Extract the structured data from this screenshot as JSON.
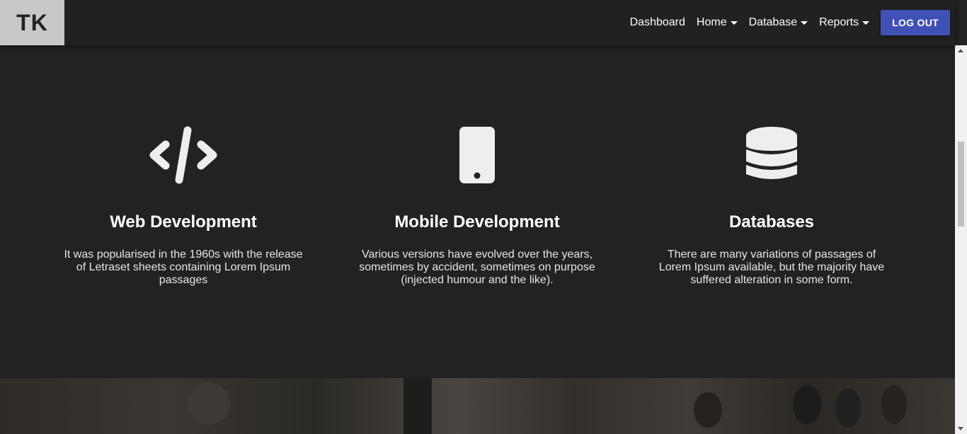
{
  "brand": {
    "label": "TK"
  },
  "nav": {
    "items": [
      {
        "label": "Dashboard",
        "dropdown": false
      },
      {
        "label": "Home",
        "dropdown": true
      },
      {
        "label": "Database",
        "dropdown": true
      },
      {
        "label": "Reports",
        "dropdown": true
      }
    ],
    "logout_label": "LOG OUT"
  },
  "features": [
    {
      "icon": "code-icon",
      "title": "Web Development",
      "text": "It was popularised in the 1960s with the release of Letraset sheets containing Lorem Ipsum passages"
    },
    {
      "icon": "mobile-icon",
      "title": "Mobile Development",
      "text": "Various versions have evolved over the years, sometimes by accident, sometimes on purpose (injected humour and the like)."
    },
    {
      "icon": "database-icon",
      "title": "Databases",
      "text": "There are many variations of passages of Lorem Ipsum available, but the majority have suffered alteration in some form."
    }
  ],
  "colors": {
    "background": "#222222",
    "navbar": "#212121",
    "brand_bg": "#c8c8c8",
    "accent": "#3f51b5",
    "icon": "#eeeeee"
  }
}
